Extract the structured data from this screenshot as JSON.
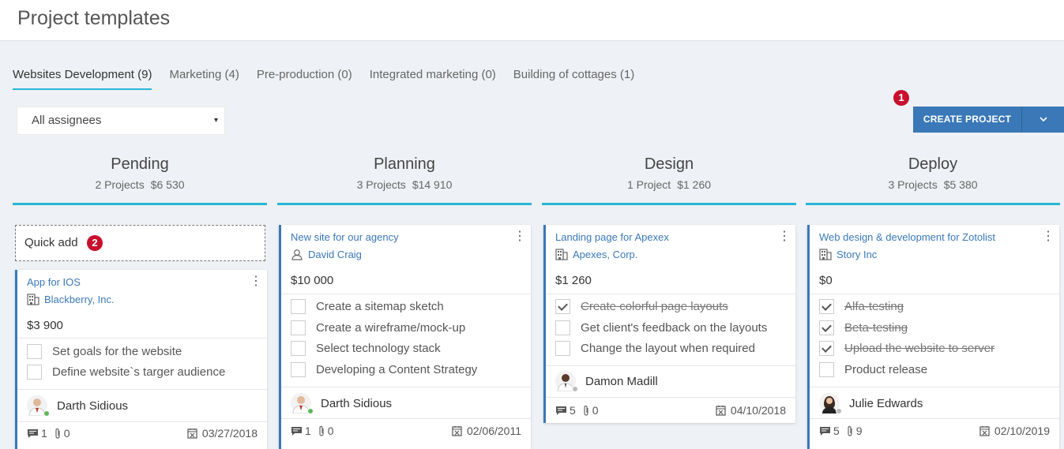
{
  "page": {
    "title": "Project templates"
  },
  "tabs": [
    {
      "label": "Websites Development (9)",
      "active": true
    },
    {
      "label": "Marketing (4)"
    },
    {
      "label": "Pre-production (0)"
    },
    {
      "label": "Integrated marketing (0)"
    },
    {
      "label": "Building of cottages (1)"
    }
  ],
  "filter": {
    "assignees_value": "All assignees",
    "caret": "▾"
  },
  "toolbar": {
    "create_label": "CREATE PROJECT",
    "badge_1": "1"
  },
  "quick_add": {
    "label": "Quick add",
    "badge_2": "2"
  },
  "colors": {
    "accent": "#29b6d6",
    "primary": "#3a78b7",
    "badge": "#c8102e",
    "online": "#5cb85c",
    "offline": "#bbbbbb"
  },
  "columns": [
    {
      "title": "Pending",
      "count": "2 Projects",
      "sum": "$6 530",
      "cards": [
        {
          "title": "App for IOS",
          "client_icon": "building-icon",
          "client": "Blackberry, Inc.",
          "amount": "$3 900",
          "tasks": [
            {
              "text": "Set goals for the website",
              "done": false
            },
            {
              "text": "Define website`s targer audience",
              "done": false
            }
          ],
          "person": "Darth Sidious",
          "online": true,
          "comments": "1",
          "attachments": "0",
          "date": "03/27/2018"
        }
      ]
    },
    {
      "title": "Planning",
      "count": "3 Projects",
      "sum": "$14 910",
      "cards": [
        {
          "title": "New site for our agency",
          "client_icon": "user-icon",
          "client": "David Craig",
          "amount": "$10 000",
          "tasks": [
            {
              "text": "Create a sitemap sketch",
              "done": false
            },
            {
              "text": "Create a wireframe/mock-up",
              "done": false
            },
            {
              "text": "Select technology stack",
              "done": false
            },
            {
              "text": "Developing a Content Strategy",
              "done": false
            }
          ],
          "person": "Darth Sidious",
          "online": true,
          "comments": "1",
          "attachments": "0",
          "date": "02/06/2011"
        }
      ]
    },
    {
      "title": "Design",
      "count": "1 Project",
      "sum": "$1 260",
      "cards": [
        {
          "title": "Landing page for Apexex",
          "client_icon": "building-icon",
          "client": "Apexes, Corp.",
          "amount": "$1 260",
          "tasks": [
            {
              "text": "Create colorful page layouts",
              "done": true
            },
            {
              "text": "Get client's feedback on the layouts",
              "done": false
            },
            {
              "text": "Change the layout when required",
              "done": false
            }
          ],
          "person": "Damon Madill",
          "online": false,
          "comments": "5",
          "attachments": "0",
          "date": "04/10/2018"
        }
      ]
    },
    {
      "title": "Deploy",
      "count": "3 Projects",
      "sum": "$5 380",
      "cards": [
        {
          "title": "Web design & development for Zotolist",
          "client_icon": "building-icon",
          "client": "Story Inc",
          "amount": "$0",
          "tasks": [
            {
              "text": "Alfa-testing",
              "done": true
            },
            {
              "text": "Beta-testing",
              "done": true
            },
            {
              "text": "Upload the website to server",
              "done": true
            },
            {
              "text": "Product release",
              "done": false
            }
          ],
          "person": "Julie Edwards",
          "online": false,
          "comments": "5",
          "attachments": "9",
          "date": "02/10/2019"
        }
      ]
    }
  ]
}
